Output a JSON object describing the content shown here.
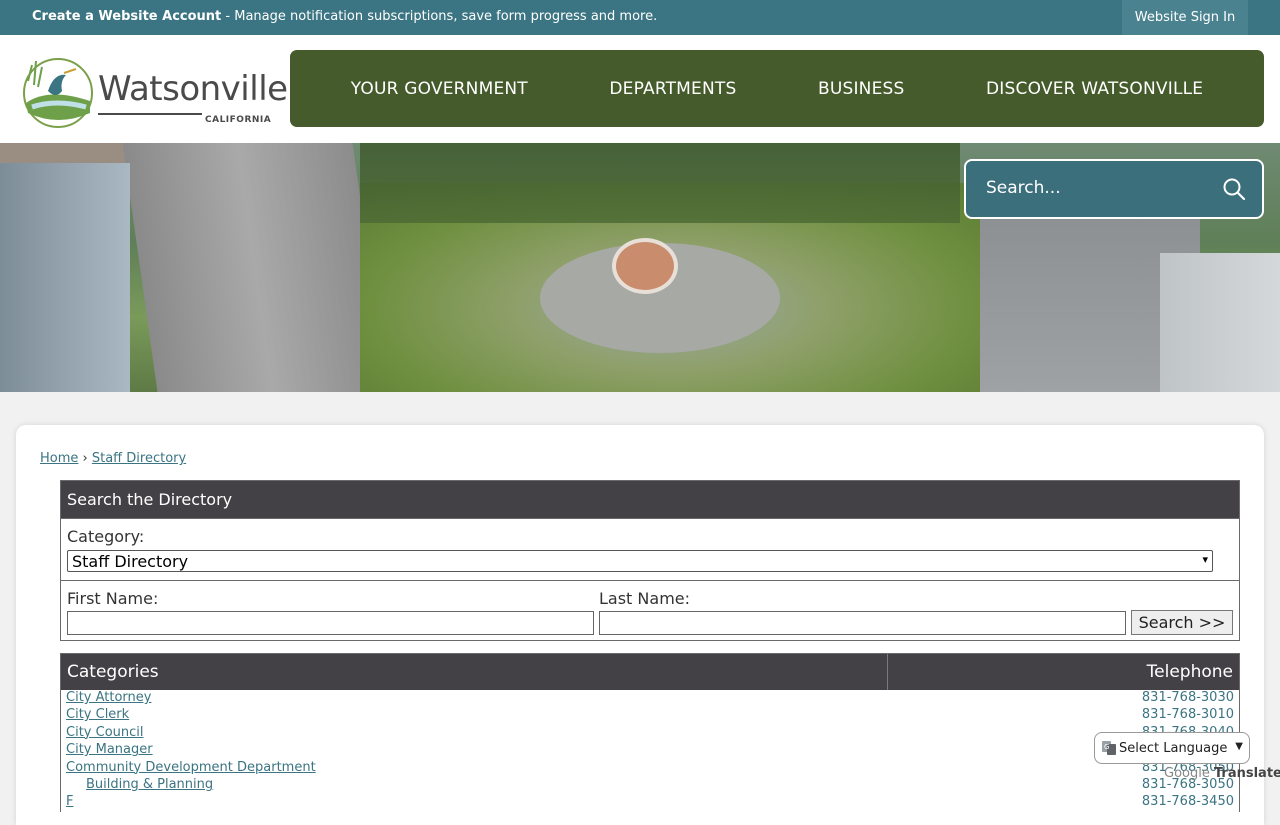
{
  "topbar": {
    "create_link": "Create a Website Account",
    "message": " - Manage notification subscriptions, save form progress and more.",
    "signin": "Website Sign In"
  },
  "logo": {
    "name": "Watsonville",
    "sub": "CALIFORNIA"
  },
  "nav": [
    "YOUR GOVERNMENT",
    "DEPARTMENTS",
    "BUSINESS",
    "DISCOVER WATSONVILLE"
  ],
  "search": {
    "placeholder": "Search..."
  },
  "breadcrumb": {
    "home": "Home",
    "sep": " › ",
    "current": "Staff Directory"
  },
  "directory": {
    "title": "Search the Directory",
    "category_label": "Category:",
    "category_value": "Staff Directory",
    "first_name_label": "First Name:",
    "last_name_label": "Last Name:",
    "search_button": "Search >>"
  },
  "table": {
    "col_categories": "Categories",
    "col_telephone": "Telephone",
    "rows": [
      {
        "name": "City Attorney",
        "tel": "831-768-3030",
        "sub": false
      },
      {
        "name": "City Clerk",
        "tel": "831-768-3010",
        "sub": false
      },
      {
        "name": "City Council",
        "tel": "831-768-3040",
        "sub": false
      },
      {
        "name": "City Manager",
        "tel": "",
        "sub": false
      },
      {
        "name": "Community Development Department",
        "tel": "831-768-3050",
        "sub": false
      },
      {
        "name": "Building & Planning",
        "tel": "831-768-3050",
        "sub": true
      },
      {
        "name": "F",
        "tel": "831-768-3450",
        "sub": false
      }
    ]
  },
  "translate": {
    "label": "Select Language",
    "powered": "Translate"
  },
  "colors": {
    "topbar": "#3b7482",
    "nav": "#465b2c",
    "link": "#3b7482",
    "table_header": "#434145"
  }
}
